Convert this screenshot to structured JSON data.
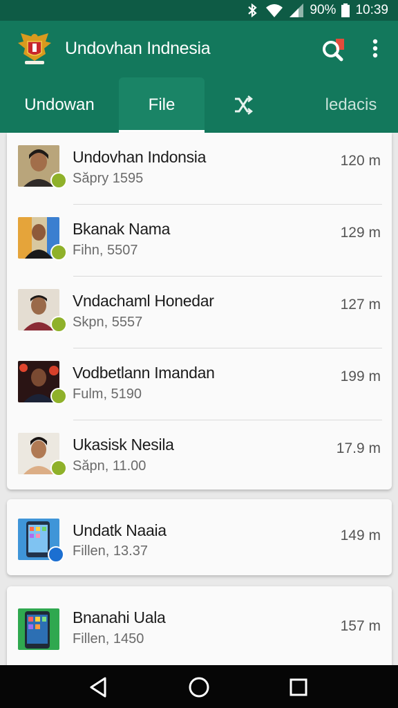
{
  "status_bar": {
    "battery": "90%",
    "time": "10:39",
    "icons": [
      "bluetooth-icon",
      "wifi-icon",
      "signal-icon",
      "battery-icon"
    ]
  },
  "app_bar": {
    "title": "Undovhan Indnesia",
    "logo_icon": "garuda-emblem-icon",
    "actions": [
      "search-icon",
      "more-vert-icon"
    ],
    "color": "#13785c"
  },
  "tabs": [
    {
      "label": "Undowan"
    },
    {
      "label": "File",
      "selected": true
    },
    {
      "label": "",
      "icon": "shuffle-icon"
    },
    {
      "label": "ledacis"
    }
  ],
  "list": [
    {
      "title": "Undovhan Indonsia",
      "subtitle": "Săpry 1595",
      "size": "120 m"
    },
    {
      "title": "Bkanak Nama",
      "subtitle": "Fihn, 5507",
      "size": "129 m"
    },
    {
      "title": "Vndachaml Honedar",
      "subtitle": "Skpn, 5557",
      "size": "127 m"
    },
    {
      "title": "Vodbetlann Imandan",
      "subtitle": "Fulm, 5190",
      "size": "199 m"
    },
    {
      "title": "Ukasisk Nesila",
      "subtitle": "Săpn, 11.00",
      "size": "17.9 m"
    },
    {
      "title": "Undatk Naaia",
      "subtitle": "Fillen, 13.37",
      "size": "149 m"
    },
    {
      "title": "Bnanahi Uala",
      "subtitle": "Fillen, 1450",
      "size": "157 m"
    }
  ],
  "nav_bar": [
    "back-icon",
    "home-icon",
    "recents-icon"
  ]
}
